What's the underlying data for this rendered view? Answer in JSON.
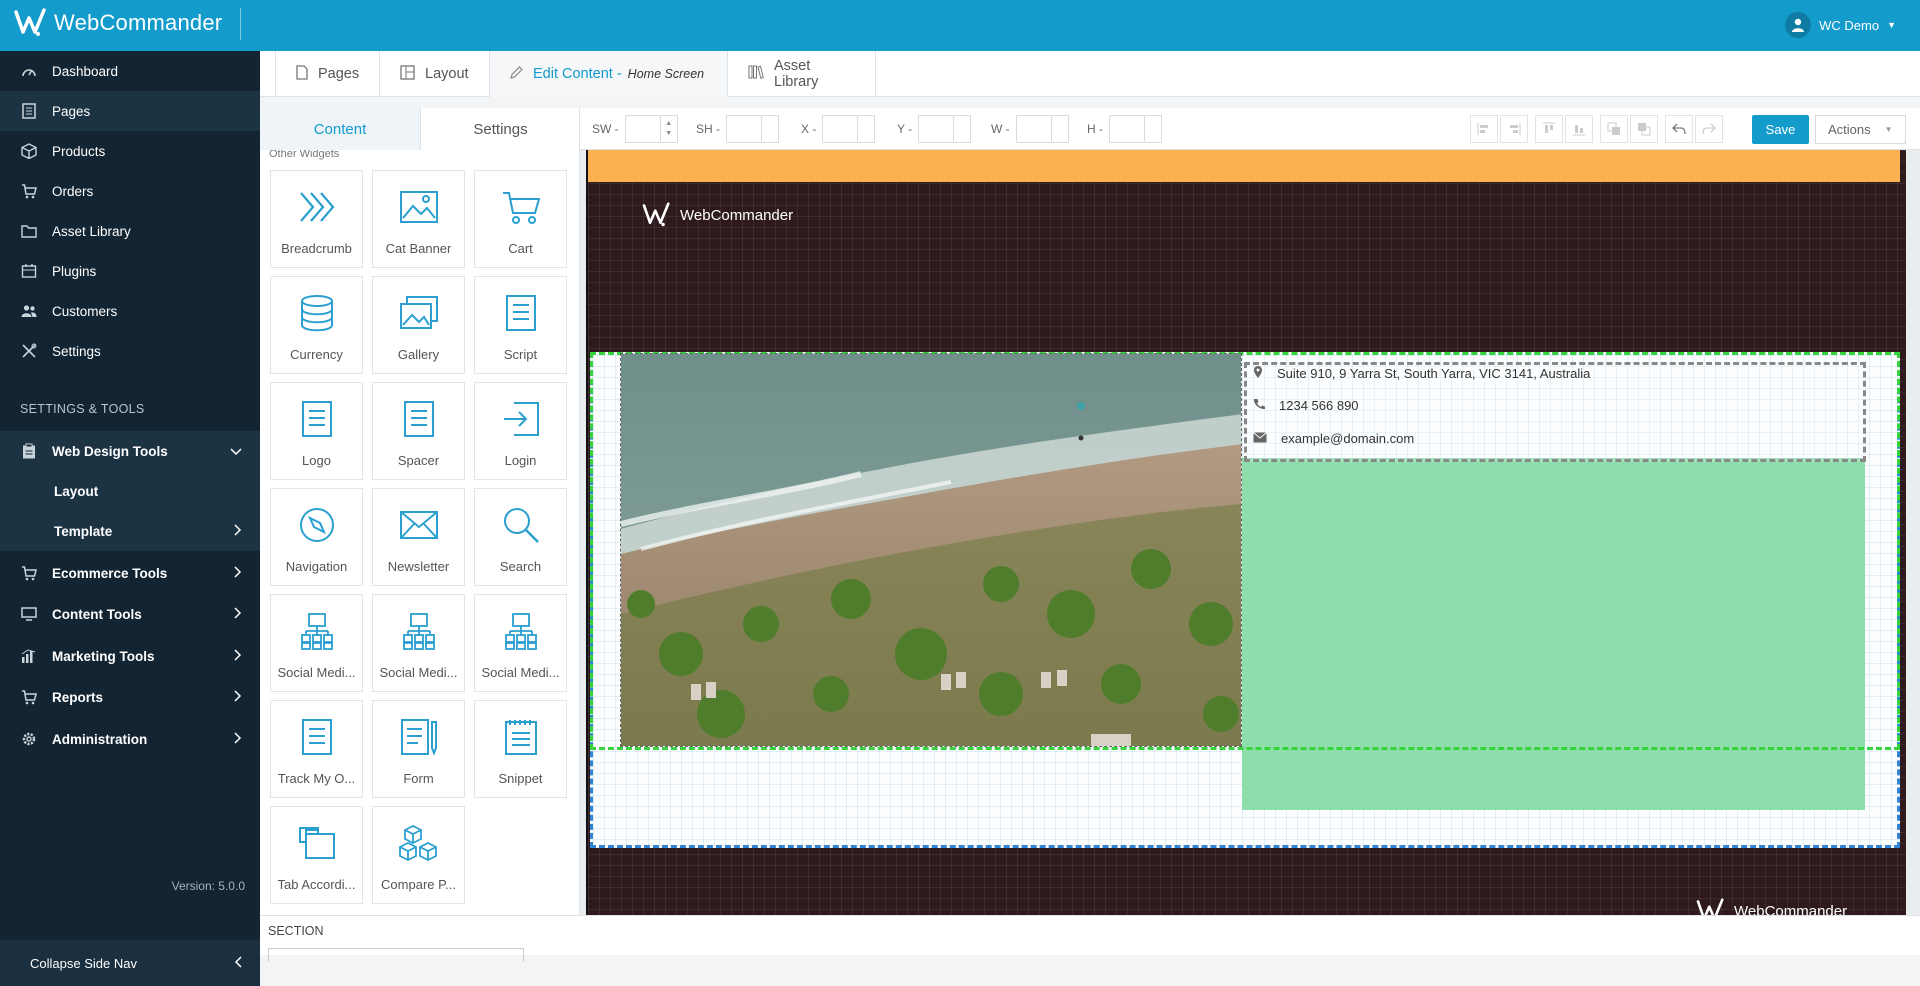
{
  "app": {
    "brand": "WebCommander",
    "user": "WC Demo"
  },
  "sidebar": {
    "items": [
      {
        "label": "Dashboard",
        "icon": "dashboard-icon"
      },
      {
        "label": "Pages",
        "icon": "pages-icon"
      },
      {
        "label": "Products",
        "icon": "box-icon"
      },
      {
        "label": "Orders",
        "icon": "cart-icon"
      },
      {
        "label": "Asset Library",
        "icon": "folder-icon"
      },
      {
        "label": "Plugins",
        "icon": "plugin-icon"
      },
      {
        "label": "Customers",
        "icon": "users-icon"
      },
      {
        "label": "Settings",
        "icon": "tools-icon"
      }
    ],
    "section_title": "SETTINGS & TOOLS",
    "tools": [
      {
        "label": "Web Design Tools",
        "icon": "clipboard-icon"
      },
      {
        "label": "Layout"
      },
      {
        "label": "Template"
      },
      {
        "label": "Ecommerce Tools",
        "icon": "cart-icon"
      },
      {
        "label": "Content Tools",
        "icon": "monitor-icon"
      },
      {
        "label": "Marketing Tools",
        "icon": "chart-icon"
      },
      {
        "label": "Reports",
        "icon": "cart-icon"
      },
      {
        "label": "Administration",
        "icon": "gear-icon"
      }
    ],
    "version": "Version: 5.0.0",
    "collapse": "Collapse Side Nav"
  },
  "tabs": {
    "pages": "Pages",
    "layout": "Layout",
    "edit_content": "Edit Content -",
    "edit_content_sub": "Home Screen",
    "asset_library": "Asset Library"
  },
  "panel": {
    "tab_content": "Content",
    "tab_settings": "Settings",
    "group_label": "Other Widgets",
    "widgets": [
      "Breadcrumb",
      "Cat Banner",
      "Cart",
      "Currency",
      "Gallery",
      "Script",
      "Logo",
      "Spacer",
      "Login",
      "Navigation",
      "Newsletter",
      "Search",
      "Social Medi...",
      "Social Medi...",
      "Social Medi...",
      "Track My O...",
      "Form",
      "Snippet",
      "Tab Accordi...",
      "Compare P..."
    ]
  },
  "toolbar": {
    "fields": [
      "SW -",
      "SH -",
      "X -",
      "Y -",
      "W -",
      "H -"
    ],
    "save": "Save",
    "actions": "Actions"
  },
  "canvas": {
    "logo_text": "WebCommander",
    "address": "Suite 910, 9 Yarra St, South Yarra, VIC 3141, Australia",
    "phone": "1234 566 890",
    "email": "example@domain.com",
    "footer_logo_text": "WebCommander"
  },
  "bottom": {
    "label": "SECTION"
  },
  "colors": {
    "primary": "#129bcb",
    "sidebar": "#132533",
    "canvas_bg": "#2e1a1d",
    "header_strip": "#fbb14f",
    "green_block": "#87dca6"
  }
}
